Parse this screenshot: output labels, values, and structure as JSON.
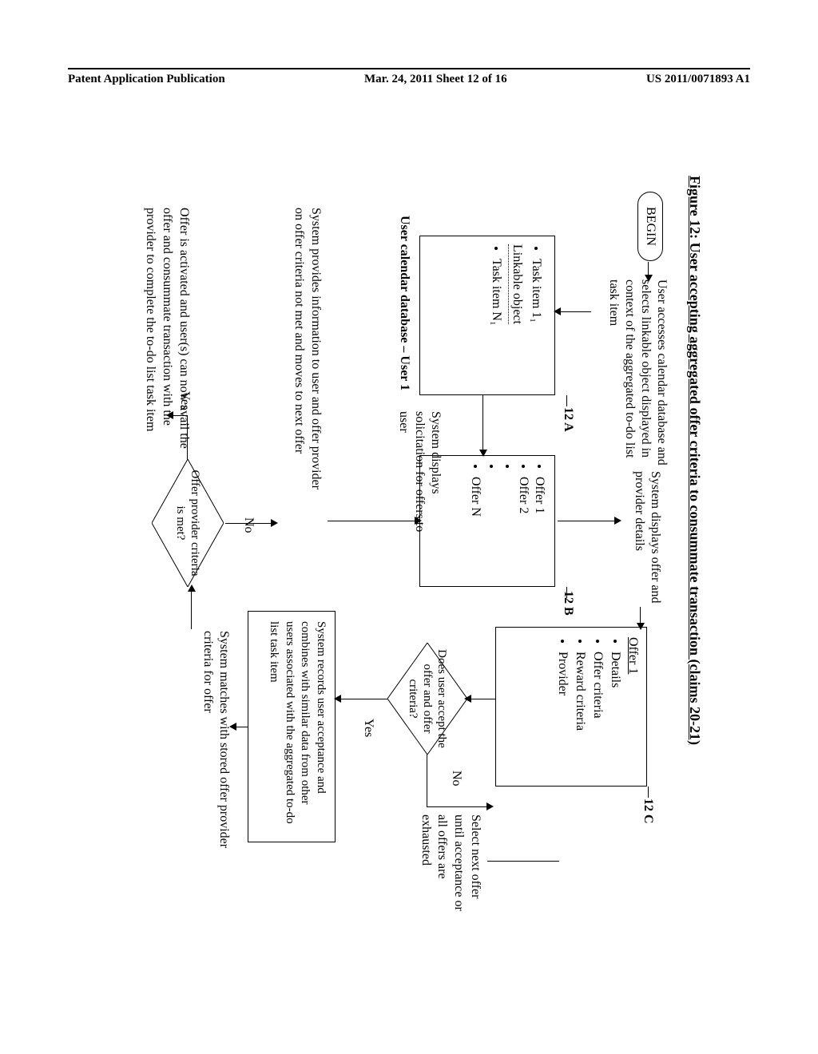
{
  "header": {
    "left": "Patent Application Publication",
    "center": "Mar. 24, 2011  Sheet 12 of 16",
    "right": "US 2011/0071893 A1"
  },
  "figure": {
    "title": "Figure 12: User accepting aggregated offer criteria to consummate transaction (claims 20-21)",
    "begin": "BEGIN",
    "access": "User accesses calendar database and selects linkable object displayed in context of the aggregated to-do list task item",
    "box12a": {
      "label": "12 A",
      "items": [
        "Task item 1₁",
        "Linkable object",
        "Task item N₁"
      ],
      "caption": "User calendar database – User 1"
    },
    "solicitation": "System displays solicitation for offers to user",
    "box12b": {
      "label": "12 B",
      "items": [
        "Offer 1",
        "Offer 2",
        "",
        "",
        "Offer N"
      ]
    },
    "display_text": "System displays offer and provider details",
    "box12c": {
      "label": "12 C",
      "heading": "Offer 1",
      "items": [
        "Details",
        "Offer criteria",
        "Reward criteria",
        "Provider"
      ]
    },
    "d1": "Does user accept the offer and offer criteria?",
    "yes": "Yes",
    "no": "No",
    "select_next": "Select next offer until acceptance or all offers are exhausted",
    "records": "System records user acceptance and combines with similar data from other users associated with the aggregated to-do list task item",
    "match": "System matches with stored offer provider criteria for offer",
    "d2": "Offer provider criteria is met?",
    "provinfo": "System provides information to user and offer provider on offer criteria not met and moves to next offer",
    "activated": "Offer is activated and user(s) can now avail the offer and consummate transaction with the provider to complete the to-do list task item"
  }
}
